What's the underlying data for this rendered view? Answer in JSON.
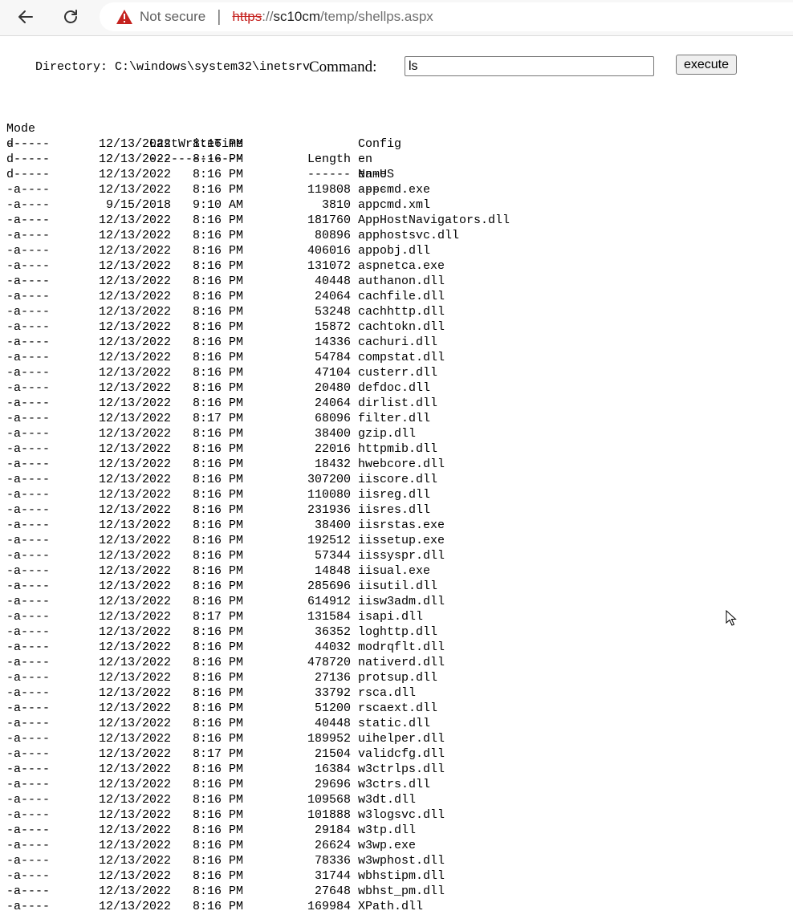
{
  "browser": {
    "security_label": "Not secure",
    "separator": "|",
    "url_scheme": "https",
    "url_scheme_sep": "://",
    "url_host": "sc10cm",
    "url_path": "/temp/shellps.aspx",
    "icons": {
      "back": "back-arrow-icon",
      "reload": "reload-icon",
      "warning": "warning-triangle-icon"
    },
    "warning_color": "#c5221f"
  },
  "form": {
    "directory_label": "Directory: C:\\windows\\system32\\inetsrv",
    "command_label": "Command:",
    "command_value": "ls",
    "execute_label": "execute"
  },
  "listing": {
    "headers": {
      "mode": "Mode",
      "lastwrite": "LastWriteTime",
      "length": "Length",
      "name": "Name"
    },
    "underlines": {
      "mode": "----",
      "lastwrite": "-------------",
      "length": "------",
      "name": "----"
    },
    "rows": [
      [
        "d-----",
        "12/13/2022",
        "8:16 PM",
        "",
        "Config"
      ],
      [
        "d-----",
        "12/13/2022",
        "8:16 PM",
        "",
        "en"
      ],
      [
        "d-----",
        "12/13/2022",
        "8:16 PM",
        "",
        "en-US"
      ],
      [
        "-a----",
        "12/13/2022",
        "8:16 PM",
        "119808",
        "appcmd.exe"
      ],
      [
        "-a----",
        "9/15/2018",
        "9:10 AM",
        "3810",
        "appcmd.xml"
      ],
      [
        "-a----",
        "12/13/2022",
        "8:16 PM",
        "181760",
        "AppHostNavigators.dll"
      ],
      [
        "-a----",
        "12/13/2022",
        "8:16 PM",
        "80896",
        "apphostsvc.dll"
      ],
      [
        "-a----",
        "12/13/2022",
        "8:16 PM",
        "406016",
        "appobj.dll"
      ],
      [
        "-a----",
        "12/13/2022",
        "8:16 PM",
        "131072",
        "aspnetca.exe"
      ],
      [
        "-a----",
        "12/13/2022",
        "8:16 PM",
        "40448",
        "authanon.dll"
      ],
      [
        "-a----",
        "12/13/2022",
        "8:16 PM",
        "24064",
        "cachfile.dll"
      ],
      [
        "-a----",
        "12/13/2022",
        "8:16 PM",
        "53248",
        "cachhttp.dll"
      ],
      [
        "-a----",
        "12/13/2022",
        "8:16 PM",
        "15872",
        "cachtokn.dll"
      ],
      [
        "-a----",
        "12/13/2022",
        "8:16 PM",
        "14336",
        "cachuri.dll"
      ],
      [
        "-a----",
        "12/13/2022",
        "8:16 PM",
        "54784",
        "compstat.dll"
      ],
      [
        "-a----",
        "12/13/2022",
        "8:16 PM",
        "47104",
        "custerr.dll"
      ],
      [
        "-a----",
        "12/13/2022",
        "8:16 PM",
        "20480",
        "defdoc.dll"
      ],
      [
        "-a----",
        "12/13/2022",
        "8:16 PM",
        "24064",
        "dirlist.dll"
      ],
      [
        "-a----",
        "12/13/2022",
        "8:17 PM",
        "68096",
        "filter.dll"
      ],
      [
        "-a----",
        "12/13/2022",
        "8:16 PM",
        "38400",
        "gzip.dll"
      ],
      [
        "-a----",
        "12/13/2022",
        "8:16 PM",
        "22016",
        "httpmib.dll"
      ],
      [
        "-a----",
        "12/13/2022",
        "8:16 PM",
        "18432",
        "hwebcore.dll"
      ],
      [
        "-a----",
        "12/13/2022",
        "8:16 PM",
        "307200",
        "iiscore.dll"
      ],
      [
        "-a----",
        "12/13/2022",
        "8:16 PM",
        "110080",
        "iisreg.dll"
      ],
      [
        "-a----",
        "12/13/2022",
        "8:16 PM",
        "231936",
        "iisres.dll"
      ],
      [
        "-a----",
        "12/13/2022",
        "8:16 PM",
        "38400",
        "iisrstas.exe"
      ],
      [
        "-a----",
        "12/13/2022",
        "8:16 PM",
        "192512",
        "iissetup.exe"
      ],
      [
        "-a----",
        "12/13/2022",
        "8:16 PM",
        "57344",
        "iissyspr.dll"
      ],
      [
        "-a----",
        "12/13/2022",
        "8:16 PM",
        "14848",
        "iisual.exe"
      ],
      [
        "-a----",
        "12/13/2022",
        "8:16 PM",
        "285696",
        "iisutil.dll"
      ],
      [
        "-a----",
        "12/13/2022",
        "8:16 PM",
        "614912",
        "iisw3adm.dll"
      ],
      [
        "-a----",
        "12/13/2022",
        "8:17 PM",
        "131584",
        "isapi.dll"
      ],
      [
        "-a----",
        "12/13/2022",
        "8:16 PM",
        "36352",
        "loghttp.dll"
      ],
      [
        "-a----",
        "12/13/2022",
        "8:16 PM",
        "44032",
        "modrqflt.dll"
      ],
      [
        "-a----",
        "12/13/2022",
        "8:16 PM",
        "478720",
        "nativerd.dll"
      ],
      [
        "-a----",
        "12/13/2022",
        "8:16 PM",
        "27136",
        "protsup.dll"
      ],
      [
        "-a----",
        "12/13/2022",
        "8:16 PM",
        "33792",
        "rsca.dll"
      ],
      [
        "-a----",
        "12/13/2022",
        "8:16 PM",
        "51200",
        "rscaext.dll"
      ],
      [
        "-a----",
        "12/13/2022",
        "8:16 PM",
        "40448",
        "static.dll"
      ],
      [
        "-a----",
        "12/13/2022",
        "8:16 PM",
        "189952",
        "uihelper.dll"
      ],
      [
        "-a----",
        "12/13/2022",
        "8:17 PM",
        "21504",
        "validcfg.dll"
      ],
      [
        "-a----",
        "12/13/2022",
        "8:16 PM",
        "16384",
        "w3ctrlps.dll"
      ],
      [
        "-a----",
        "12/13/2022",
        "8:16 PM",
        "29696",
        "w3ctrs.dll"
      ],
      [
        "-a----",
        "12/13/2022",
        "8:16 PM",
        "109568",
        "w3dt.dll"
      ],
      [
        "-a----",
        "12/13/2022",
        "8:16 PM",
        "101888",
        "w3logsvc.dll"
      ],
      [
        "-a----",
        "12/13/2022",
        "8:16 PM",
        "29184",
        "w3tp.dll"
      ],
      [
        "-a----",
        "12/13/2022",
        "8:16 PM",
        "26624",
        "w3wp.exe"
      ],
      [
        "-a----",
        "12/13/2022",
        "8:16 PM",
        "78336",
        "w3wphost.dll"
      ],
      [
        "-a----",
        "12/13/2022",
        "8:16 PM",
        "31744",
        "wbhstipm.dll"
      ],
      [
        "-a----",
        "12/13/2022",
        "8:16 PM",
        "27648",
        "wbhst_pm.dll"
      ],
      [
        "-a----",
        "12/13/2022",
        "8:16 PM",
        "169984",
        "XPath.dll"
      ]
    ]
  }
}
